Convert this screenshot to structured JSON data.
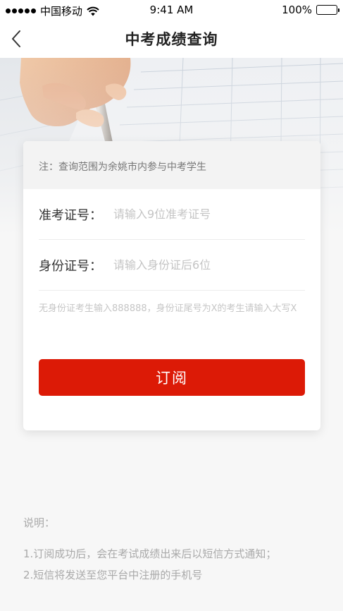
{
  "status_bar": {
    "carrier": "中国移动",
    "time": "9:41 AM",
    "battery": "100%",
    "battery_level": 1.0,
    "icons": [
      "signal-icon",
      "wifi-icon",
      "battery-icon"
    ]
  },
  "nav": {
    "title": "中考成绩查询",
    "back_icon": "chevron-left-icon"
  },
  "card": {
    "note": "注：查询范围为余姚市内参与中考学生",
    "fields": [
      {
        "label": "准考证号：",
        "placeholder": "请输入9位准考证号",
        "value": ""
      },
      {
        "label": "身份证号：",
        "placeholder": "请输入身份证后6位",
        "value": ""
      }
    ],
    "hint": "无身份证考生输入888888，身份证尾号为X的考生请输入大写X",
    "submit_label": "订阅"
  },
  "notes": {
    "title": "说明：",
    "items": [
      "1.订阅成功后，会在考试成绩出来后以短信方式通知；",
      "2.短信将发送至您平台中注册的手机号"
    ]
  },
  "colors": {
    "accent": "#dc1a06",
    "background": "#f7f7f7",
    "placeholder": "#c4c4c4"
  }
}
